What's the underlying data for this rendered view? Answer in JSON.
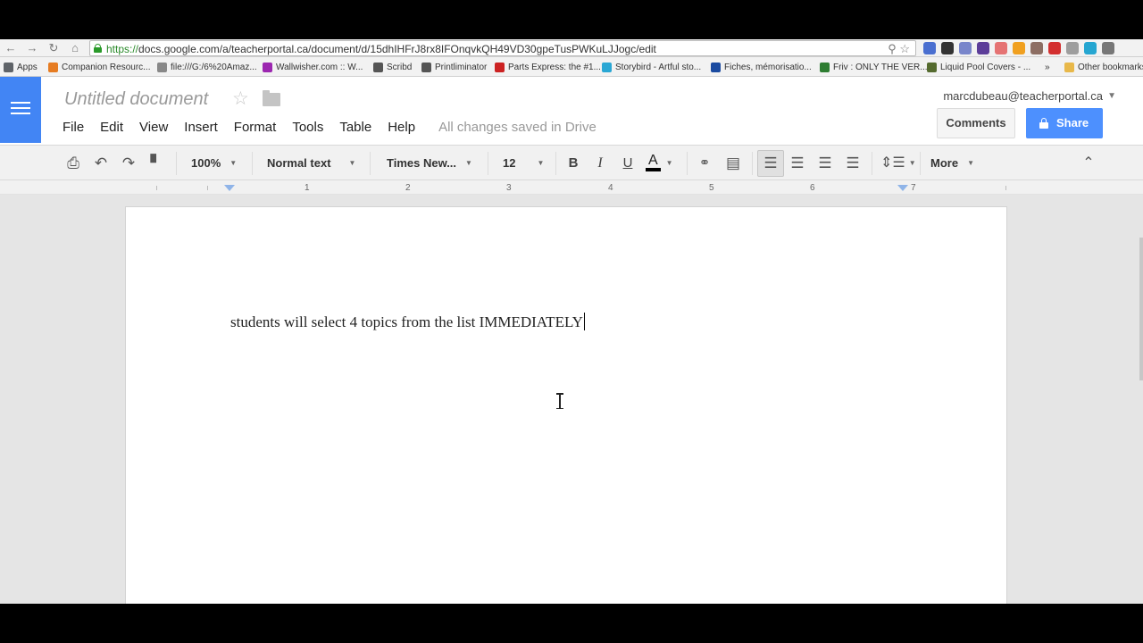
{
  "browser": {
    "url_scheme": "https://",
    "url_rest": "docs.google.com/a/teacherportal.ca/document/d/15dhIHFrJ8rx8IFOnqvkQH49VD30gpeTusPWKuLJJogc/edit",
    "bookmarks": [
      {
        "label": "Apps",
        "color": "#5f6368"
      },
      {
        "label": "Companion Resourc...",
        "color": "#e67c22"
      },
      {
        "label": "file:///G:/6%20Amaz...",
        "color": "#888888"
      },
      {
        "label": "Wallwisher.com :: W...",
        "color": "#9c27b0"
      },
      {
        "label": "Scribd",
        "color": "#555555"
      },
      {
        "label": "Printliminator",
        "color": "#555555"
      },
      {
        "label": "Parts Express: the #1...",
        "color": "#cc2222"
      },
      {
        "label": "Storybird - Artful sto...",
        "color": "#2aa7d4"
      },
      {
        "label": "Fiches, mémorisatio...",
        "color": "#1a4aa0"
      },
      {
        "label": "Friv : ONLY THE VER...",
        "color": "#2e7d32"
      },
      {
        "label": "Liquid Pool Covers - ...",
        "color": "#556b2f"
      },
      {
        "label": "»",
        "color": ""
      },
      {
        "label": "Other bookmarks",
        "color": "#e8b84a"
      }
    ]
  },
  "header": {
    "title": "Untitled document",
    "menu": [
      "File",
      "Edit",
      "View",
      "Insert",
      "Format",
      "Tools",
      "Table",
      "Help"
    ],
    "saved_status": "All changes saved in Drive",
    "account": "marcdubeau@teacherportal.ca",
    "comments_label": "Comments",
    "share_label": "Share"
  },
  "toolbar": {
    "zoom": "100%",
    "style": "Normal text",
    "font": "Times New...",
    "size": "12",
    "bold": "B",
    "italic": "I",
    "underline": "U",
    "text_color": "A",
    "more": "More"
  },
  "ruler": {
    "numbers": [
      "1",
      "2",
      "3",
      "4",
      "5",
      "6",
      "7"
    ]
  },
  "document": {
    "text": "students will select 4 topics from the list IMMEDIATELY"
  }
}
